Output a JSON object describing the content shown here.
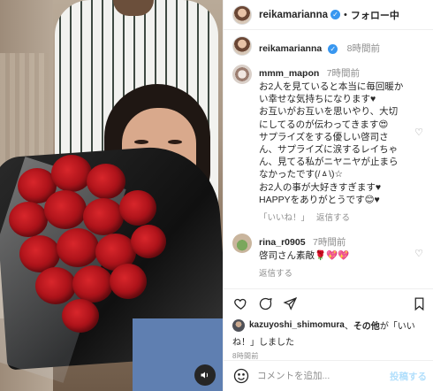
{
  "header": {
    "username": "reikamarianna",
    "separator": "•",
    "follow_label": "フォロー中"
  },
  "caption": {
    "username": "reikamarianna",
    "time": "8時間前"
  },
  "comments": [
    {
      "username": "mmm_mapon",
      "time": "7時間前",
      "text": "お2人を見ていると本当に毎回暖か\nい幸せな気持ちになります♥\nお互いがお互いを思いやり、大切\nにしてるのが伝わってきます😍\nサプライズをする優しい啓司さ\nん、サプライズに涙するレイちゃ\nん、見てる私がニヤニヤが止まら\nなかったです(/ㅿ\\)☆\nお2人の事が大好きすぎます♥\nHAPPYをありがとうです😊♥",
      "likes_label": "「いいね！」",
      "reply_label": "返信する"
    },
    {
      "username": "rina_r0905",
      "time": "7時間前",
      "text": "啓司さん素敵🌹💖💖",
      "reply_label": "返信する"
    }
  ],
  "likes": {
    "user": "kazuyoshi_shimomura",
    "mid": "、",
    "others": "その他",
    "suffix": "が「いい",
    "line2": "ね！」しました"
  },
  "posted_time": "8時間前",
  "comment_input": {
    "placeholder": "コメントを追加...",
    "post_label": "投稿する"
  },
  "icons": {
    "verified": "verified-badge-icon",
    "like": "heart-icon",
    "comment": "comment-bubble-icon",
    "share": "paper-plane-icon",
    "save": "bookmark-icon",
    "emoji": "smiley-icon",
    "mute": "speaker-icon"
  },
  "colors": {
    "verified_blue": "#3897f0",
    "post_button_disabled": "#b2dffc",
    "secondary_text": "#8e8e8e"
  }
}
